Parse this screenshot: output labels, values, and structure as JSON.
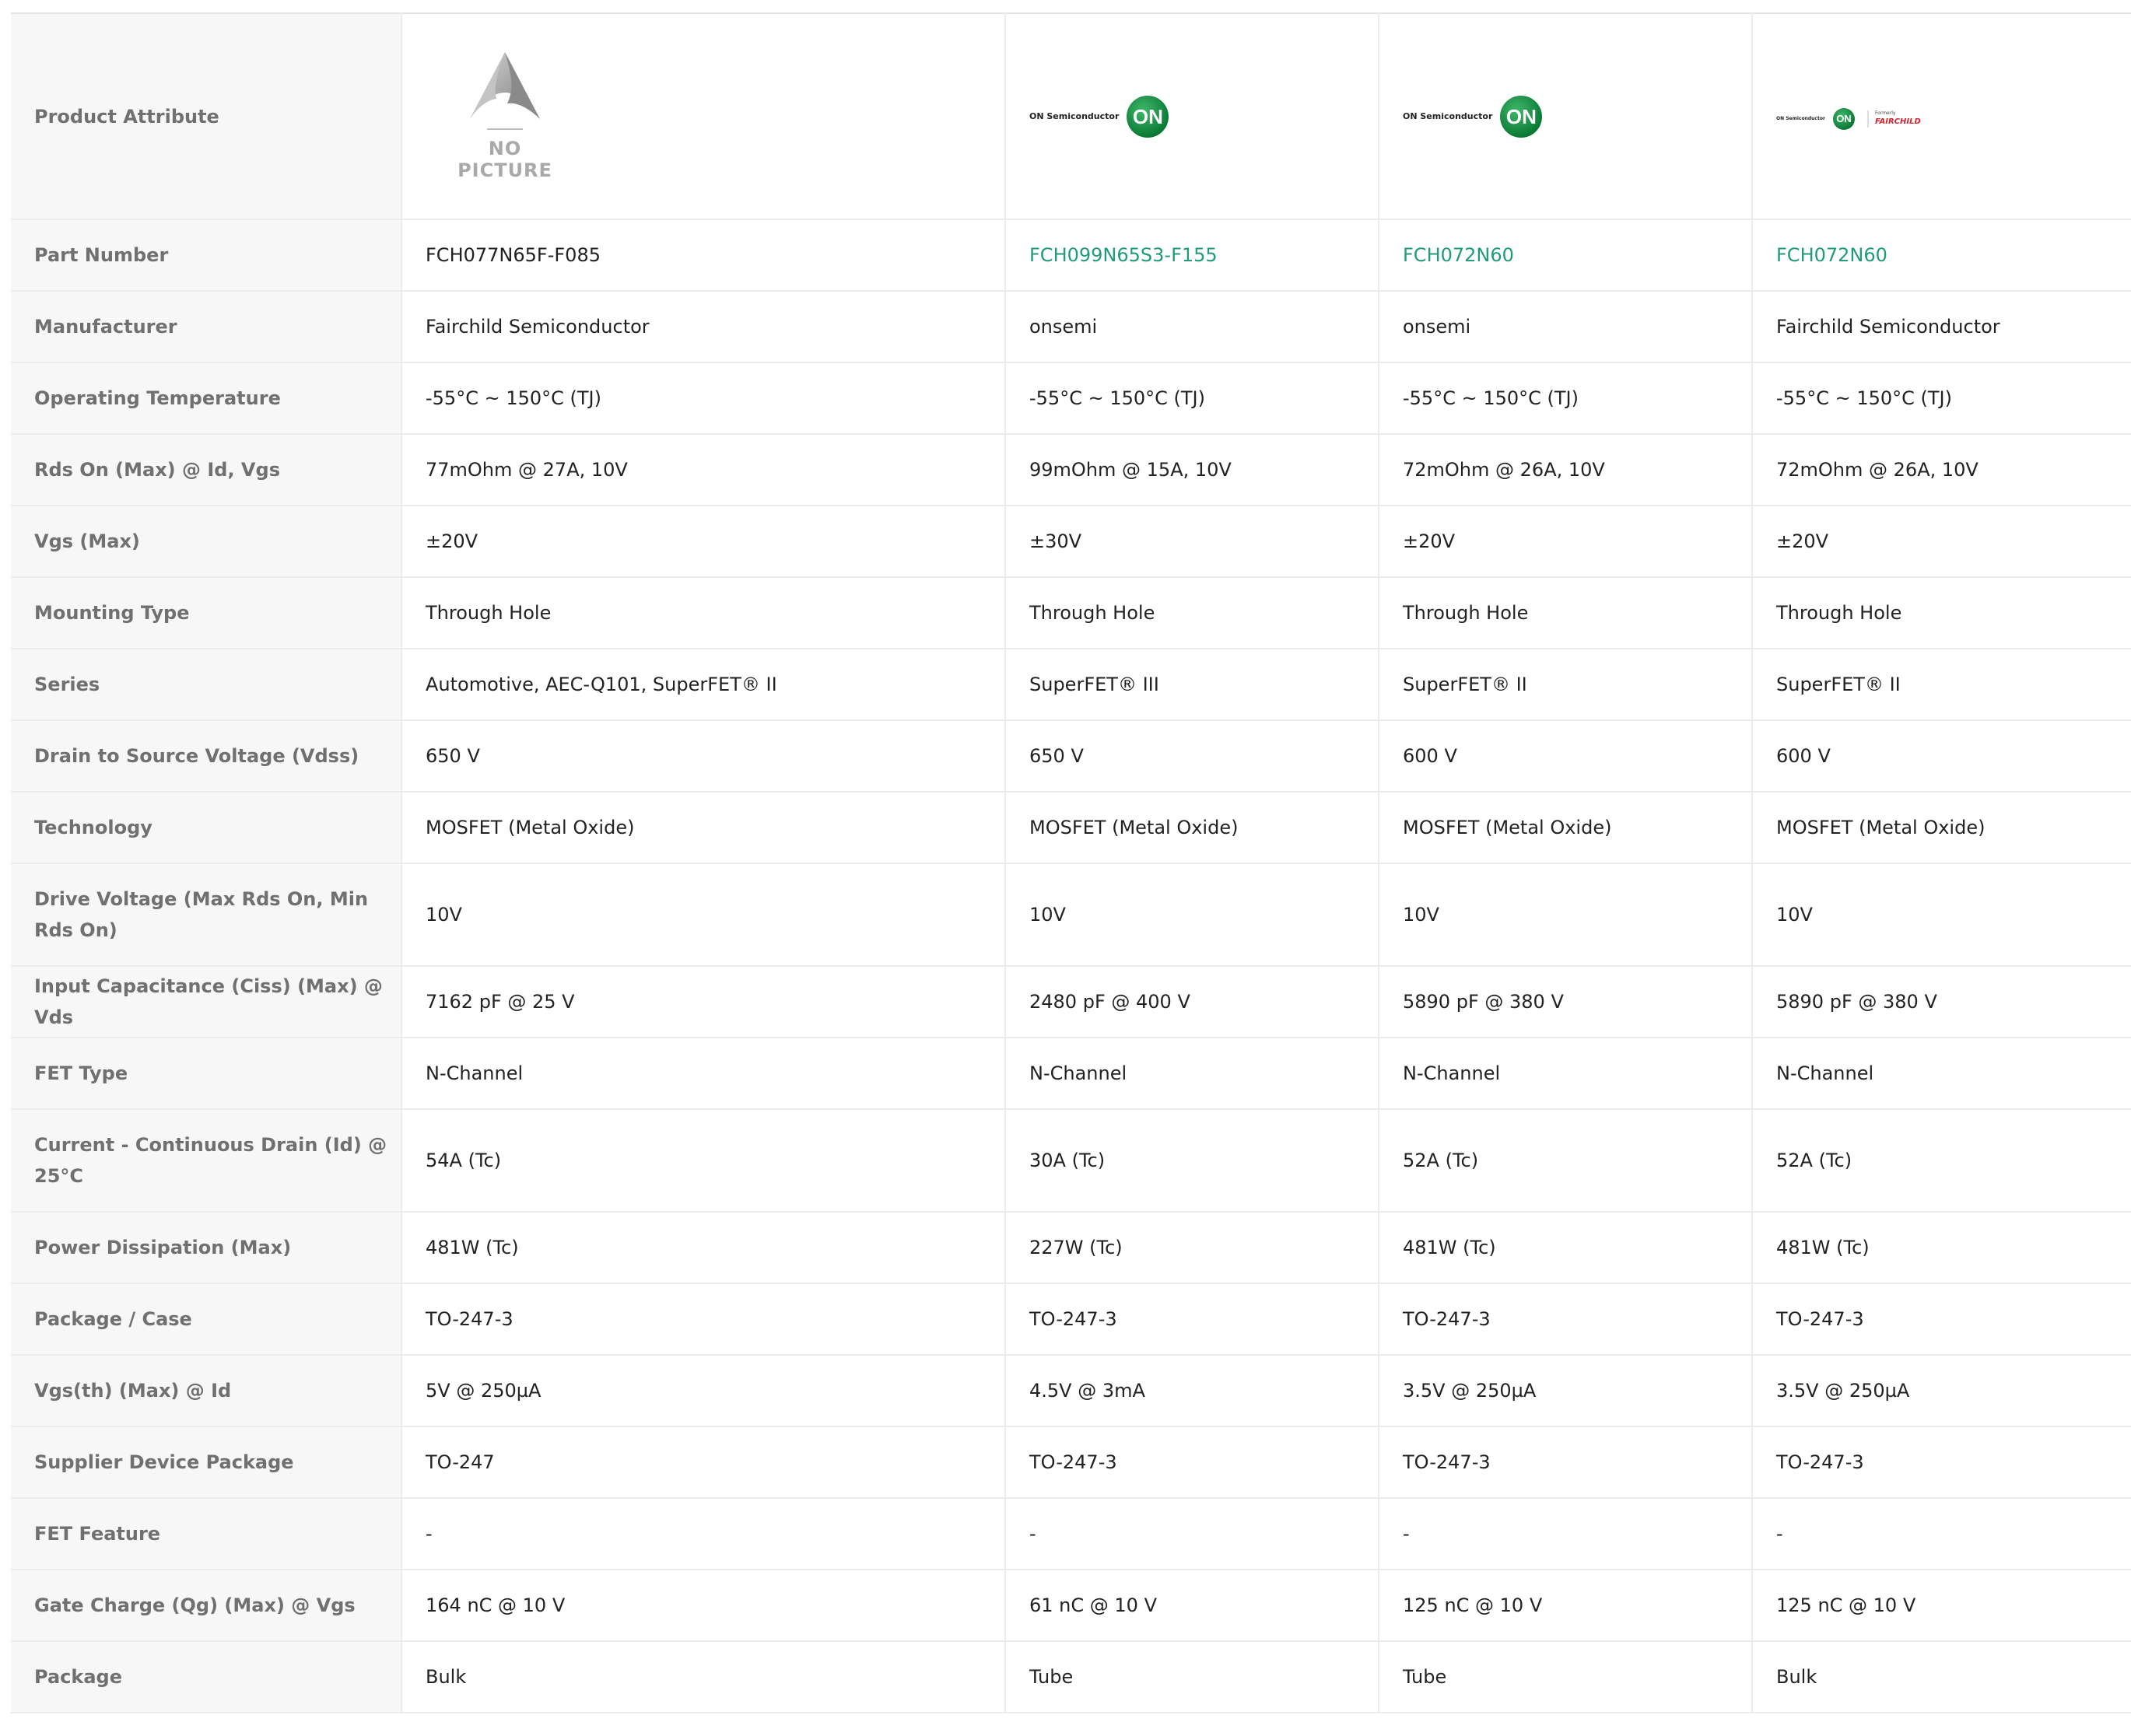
{
  "header": {
    "attribute_label": "Product Attribute",
    "no_picture_text": "NO PICTURE",
    "logos": [
      {
        "type": "none"
      },
      {
        "type": "onsemi",
        "word": "ON Semiconductor",
        "mark": "ON"
      },
      {
        "type": "onsemi",
        "word": "ON Semiconductor",
        "mark": "ON"
      },
      {
        "type": "onsemi-fairchild",
        "word": "ON Semiconductor",
        "mark": "ON",
        "formerly": "Formerly",
        "fair": "FAIRCHILD"
      }
    ]
  },
  "colors": {
    "link": "#1f9c7a",
    "attr_bg": "#f7f7f7",
    "attr_text": "#707070",
    "on_green": "#0b7a35",
    "fairchild_red": "#d5232f"
  },
  "rows": [
    {
      "label": "Part Number",
      "values": [
        "FCH077N65F-F085",
        "FCH099N65S3-F155",
        "FCH072N60",
        "FCH072N60"
      ]
    },
    {
      "label": "Manufacturer",
      "values": [
        "Fairchild Semiconductor",
        "onsemi",
        "onsemi",
        "Fairchild Semiconductor"
      ]
    },
    {
      "label": "Operating Temperature",
      "values": [
        "-55°C ~ 150°C (TJ)",
        "-55°C ~ 150°C (TJ)",
        "-55°C ~ 150°C (TJ)",
        "-55°C ~ 150°C (TJ)"
      ]
    },
    {
      "label": "Rds On (Max) @ Id, Vgs",
      "values": [
        "77mOhm @ 27A, 10V",
        "99mOhm @ 15A, 10V",
        "72mOhm @ 26A, 10V",
        "72mOhm @ 26A, 10V"
      ]
    },
    {
      "label": "Vgs (Max)",
      "values": [
        "±20V",
        "±30V",
        "±20V",
        "±20V"
      ]
    },
    {
      "label": "Mounting Type",
      "values": [
        "Through Hole",
        "Through Hole",
        "Through Hole",
        "Through Hole"
      ]
    },
    {
      "label": "Series",
      "values": [
        "Automotive, AEC-Q101, SuperFET® II",
        "SuperFET® III",
        "SuperFET® II",
        "SuperFET® II"
      ]
    },
    {
      "label": "Drain to Source Voltage (Vdss)",
      "values": [
        "650 V",
        "650 V",
        "600 V",
        "600 V"
      ]
    },
    {
      "label": "Technology",
      "values": [
        "MOSFET (Metal Oxide)",
        "MOSFET (Metal Oxide)",
        "MOSFET (Metal Oxide)",
        "MOSFET (Metal Oxide)"
      ]
    },
    {
      "label": "Drive Voltage (Max Rds On, Min Rds On)",
      "values": [
        "10V",
        "10V",
        "10V",
        "10V"
      ]
    },
    {
      "label": "Input Capacitance (Ciss) (Max) @ Vds",
      "values": [
        "7162 pF @ 25 V",
        "2480 pF @ 400 V",
        "5890 pF @ 380 V",
        "5890 pF @ 380 V"
      ]
    },
    {
      "label": "FET Type",
      "values": [
        "N-Channel",
        "N-Channel",
        "N-Channel",
        "N-Channel"
      ]
    },
    {
      "label": "Current - Continuous Drain (Id) @ 25°C",
      "values": [
        "54A (Tc)",
        "30A (Tc)",
        "52A (Tc)",
        "52A (Tc)"
      ]
    },
    {
      "label": "Power Dissipation (Max)",
      "values": [
        "481W (Tc)",
        "227W (Tc)",
        "481W (Tc)",
        "481W (Tc)"
      ]
    },
    {
      "label": "Package / Case",
      "values": [
        "TO-247-3",
        "TO-247-3",
        "TO-247-3",
        "TO-247-3"
      ]
    },
    {
      "label": "Vgs(th) (Max) @ Id",
      "values": [
        "5V @ 250µA",
        "4.5V @ 3mA",
        "3.5V @ 250µA",
        "3.5V @ 250µA"
      ]
    },
    {
      "label": "Supplier Device Package",
      "values": [
        "TO-247",
        "TO-247-3",
        "TO-247-3",
        "TO-247-3"
      ]
    },
    {
      "label": "FET Feature",
      "values": [
        "-",
        "-",
        "-",
        "-"
      ]
    },
    {
      "label": "Gate Charge (Qg) (Max) @ Vgs",
      "values": [
        "164 nC @ 10 V",
        "61 nC @ 10 V",
        "125 nC @ 10 V",
        "125 nC @ 10 V"
      ]
    },
    {
      "label": "Package",
      "values": [
        "Bulk",
        "Tube",
        "Tube",
        "Bulk"
      ]
    }
  ]
}
